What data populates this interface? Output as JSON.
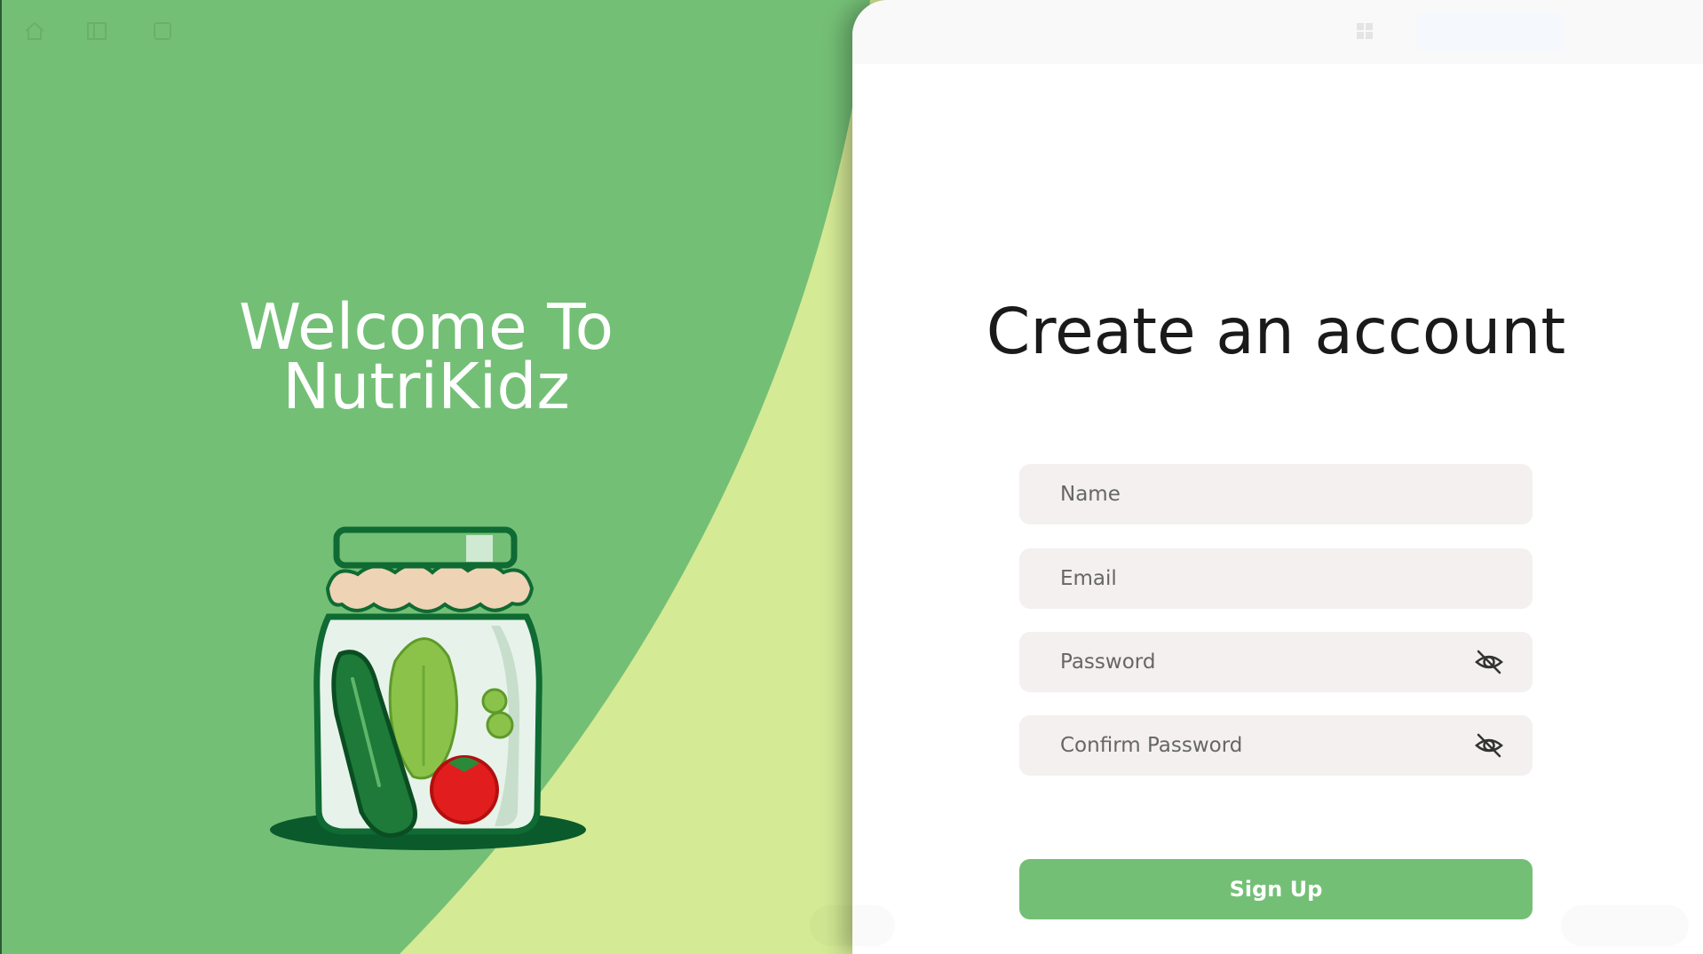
{
  "app": {
    "name": "NutriKidz"
  },
  "welcome": {
    "line1": "Welcome To",
    "line2": "NutriKidz"
  },
  "form": {
    "title": "Create an account",
    "name_placeholder": "Name",
    "email_placeholder": "Email",
    "password_placeholder": "Password",
    "confirm_placeholder": "Confirm Password",
    "signup_label": "Sign Up"
  },
  "colors": {
    "primary_green": "#74bf76",
    "light_green": "#d4ea95",
    "dark_green": "#0f5a2c",
    "field_bg": "#f3f0ef"
  },
  "icons": {
    "password_toggle": "eye-off-icon",
    "confirm_toggle": "eye-off-icon",
    "illustration": "vegetable-jar-illustration"
  }
}
